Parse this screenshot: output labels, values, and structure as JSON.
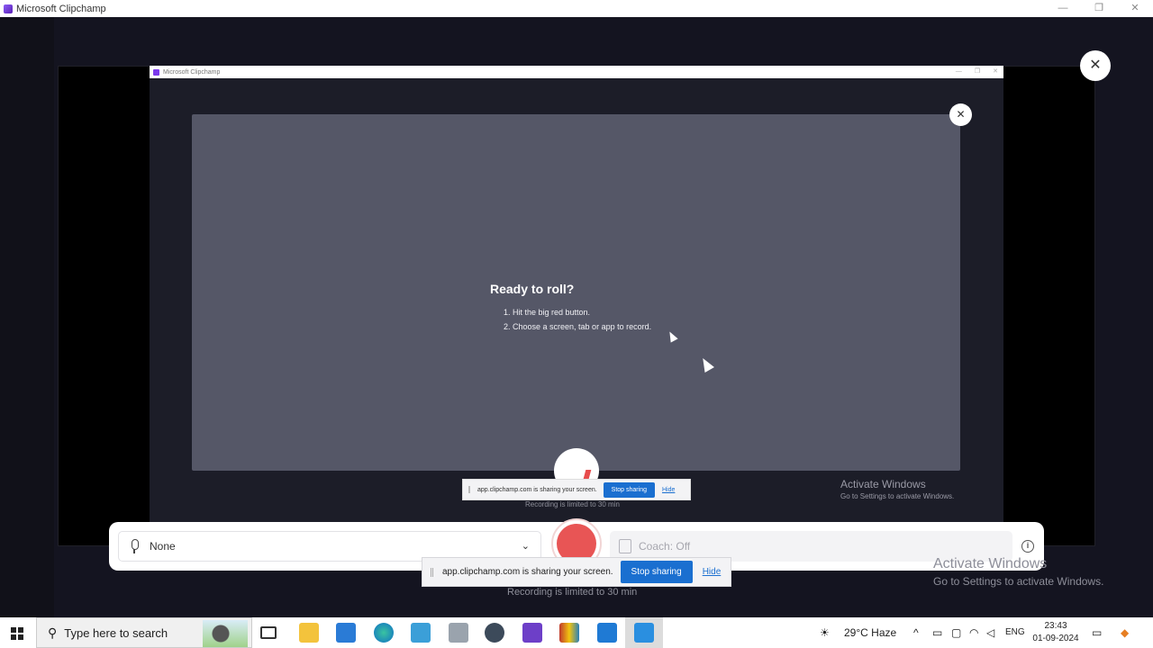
{
  "window": {
    "title": "Microsoft Clipchamp",
    "controls": [
      "—",
      "❐",
      "✕"
    ]
  },
  "inner_window": {
    "title": "Microsoft Clipchamp"
  },
  "preview": {
    "heading": "Ready to roll?",
    "steps": [
      "1. Hit the big red button.",
      "2. Choose a screen, tab or app to record."
    ]
  },
  "share_bar_small": {
    "message": "app.clipchamp.com is sharing your screen.",
    "stop_label": "Stop sharing",
    "hide_label": "Hide"
  },
  "limit_small": "Recording is limited to 30 min",
  "activate_small": {
    "line1": "Activate Windows",
    "line2": "Go to Settings to activate Windows."
  },
  "controls": {
    "mic_value": "None",
    "coach_label": "Coach: Off"
  },
  "share_bar": {
    "message": "app.clipchamp.com is sharing your screen.",
    "stop_label": "Stop sharing",
    "hide_label": "Hide"
  },
  "limit": "Recording is limited to 30 min",
  "activate": {
    "line1": "Activate Windows",
    "line2": "Go to Settings to activate Windows."
  },
  "taskbar": {
    "search_placeholder": "Type here to search",
    "weather": "29°C Haze",
    "language": "ENG",
    "time": "23:43",
    "date": "01-09-2024",
    "icons": [
      "task-view-icon",
      "file-explorer-icon",
      "store-icon",
      "edge-icon",
      "mail-icon",
      "photos-icon",
      "settings-icon",
      "clipchamp-icon",
      "winrar-icon",
      "vscode-icon",
      "active-app-icon"
    ]
  },
  "colors": {
    "record": "#e85555",
    "accent": "#1a6fd0",
    "preview_bg": "#555767"
  }
}
